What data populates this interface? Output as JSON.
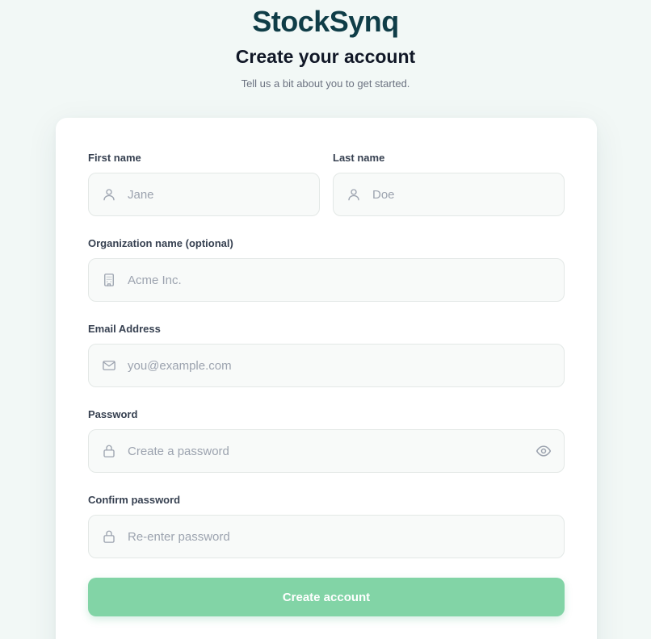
{
  "brand": "StockSynq",
  "title": "Create your account",
  "subtitle": "Tell us a bit about you to get started.",
  "colors": {
    "brand": "#0f3d47",
    "accent": "#82d4a6",
    "background": "#f2f8f6"
  },
  "form": {
    "first_name": {
      "label": "First name",
      "placeholder": "Jane",
      "value": "",
      "icon": "user-icon"
    },
    "last_name": {
      "label": "Last name",
      "placeholder": "Doe",
      "value": "",
      "icon": "user-icon"
    },
    "organization": {
      "label": "Organization name (optional)",
      "placeholder": "Acme Inc.",
      "value": "",
      "icon": "building-icon"
    },
    "email": {
      "label": "Email Address",
      "placeholder": "you@example.com",
      "value": "",
      "icon": "mail-icon"
    },
    "password": {
      "label": "Password",
      "placeholder": "Create a password",
      "value": "",
      "icon": "lock-icon",
      "toggle_icon": "eye-icon"
    },
    "confirm_password": {
      "label": "Confirm password",
      "placeholder": "Re-enter password",
      "value": "",
      "icon": "lock-icon"
    },
    "submit_label": "Create account"
  }
}
